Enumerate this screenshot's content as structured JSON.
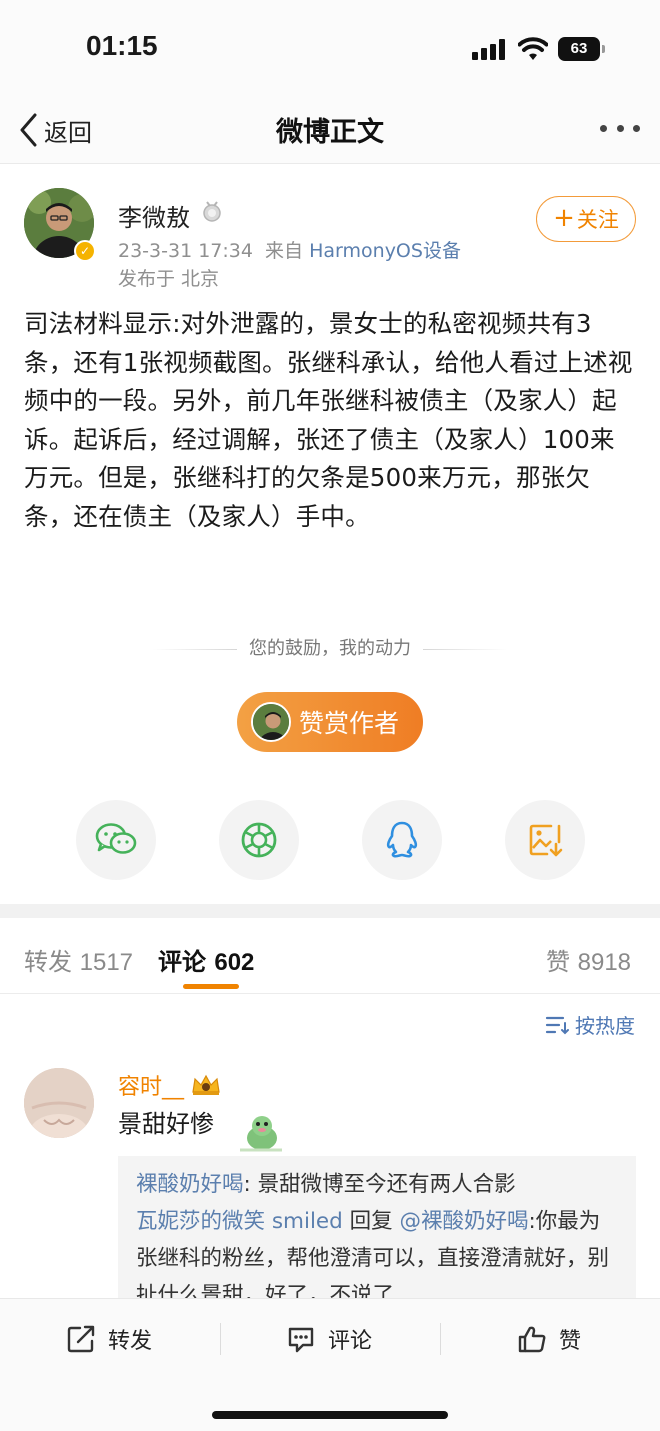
{
  "status_bar": {
    "time": "01:15",
    "battery": "63"
  },
  "nav": {
    "back_label": "返回",
    "title": "微博正文"
  },
  "author": {
    "name": "李微敖",
    "meta_time": "23-3-31 17:34",
    "meta_via": "来自",
    "meta_device": "HarmonyOS设备",
    "location": "发布于 北京",
    "follow_label": "关注"
  },
  "post": {
    "text": "司法材料显示:对外泄露的，景女士的私密视频共有3条，还有1张视频截图。张继科承认，给他人看过上述视频中的一段。另外，前几年张继科被债主（及家人）起诉。起诉后，经过调解，张还了债主（及家人）100来万元。但是，张继科打的欠条是500来万元，那张欠条，还在债主（及家人）手中。"
  },
  "reward": {
    "caption": "您的鼓励，我的动力",
    "button_label": "赞赏作者"
  },
  "share": [
    "wechat-icon",
    "moments-icon",
    "qq-icon",
    "save-image-icon"
  ],
  "tabs": {
    "repost_label": "转发",
    "repost_count": "1517",
    "comment_label": "评论",
    "comment_count": "602",
    "like_label": "赞",
    "like_count": "8918"
  },
  "sort": {
    "label": "按热度"
  },
  "comment": {
    "user": "容时__",
    "text": "景甜好惨",
    "replies": [
      {
        "user": "裸酸奶好喝",
        "text": ": 景甜微博至今还有两人合影"
      },
      {
        "user": "瓦妮莎的微笑 smiled",
        "mid": " 回复 ",
        "mention": "@裸酸奶好喝",
        "text": ":你最为张继科的粉丝，帮他澄清可以，直接澄清就好，别扯什么景甜，好了，不说了"
      }
    ]
  },
  "bottom_bar": {
    "repost": "转发",
    "comment": "评论",
    "like": "赞"
  },
  "colors": {
    "accent": "#f08300",
    "link": "#5b7fae"
  }
}
